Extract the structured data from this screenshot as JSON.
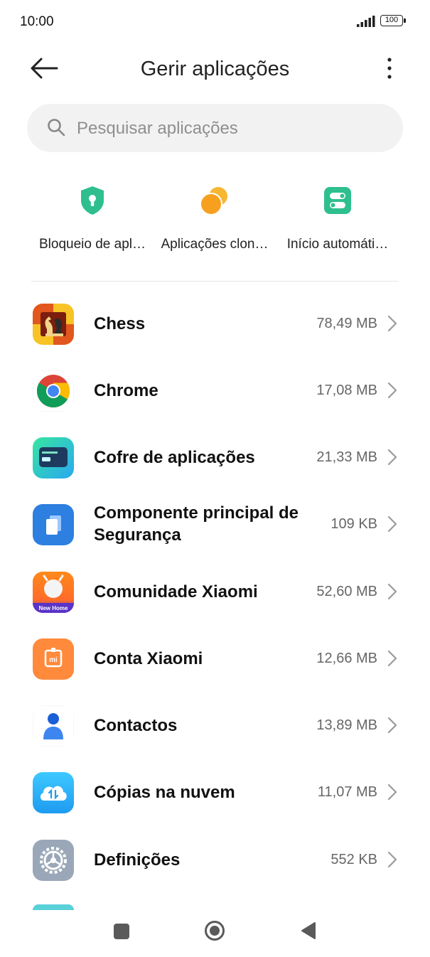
{
  "status_bar": {
    "time": "10:00",
    "battery": "100"
  },
  "header": {
    "title": "Gerir aplicações"
  },
  "search": {
    "placeholder": "Pesquisar aplicações"
  },
  "shortcuts": [
    {
      "label": "Bloqueio de apl…",
      "icon": "shield-lock-icon",
      "color": "#2fbf8f"
    },
    {
      "label": "Aplicações clon…",
      "icon": "dual-circles-icon",
      "color": "#f7a928"
    },
    {
      "label": "Início automáti…",
      "icon": "toggle-switches-icon",
      "color": "#2fbf8f"
    }
  ],
  "apps": [
    {
      "name": "Chess",
      "size": "78,49 MB",
      "icon": "chess-app-icon"
    },
    {
      "name": "Chrome",
      "size": "17,08 MB",
      "icon": "chrome-app-icon"
    },
    {
      "name": "Cofre de aplicações",
      "size": "21,33 MB",
      "icon": "app-vault-icon"
    },
    {
      "name": "Componente principal de Segurança",
      "size": "109 KB",
      "icon": "security-component-icon"
    },
    {
      "name": "Comunidade Xiaomi",
      "size": "52,60 MB",
      "icon": "xiaomi-community-icon",
      "badge": "New Home"
    },
    {
      "name": "Conta Xiaomi",
      "size": "12,66 MB",
      "icon": "xiaomi-account-icon",
      "badge": "mi"
    },
    {
      "name": "Contactos",
      "size": "13,89 MB",
      "icon": "contacts-app-icon"
    },
    {
      "name": "Cópias na nuvem",
      "size": "11,07 MB",
      "icon": "cloud-backup-icon"
    },
    {
      "name": "Definições",
      "size": "552 KB",
      "icon": "settings-app-icon"
    }
  ]
}
